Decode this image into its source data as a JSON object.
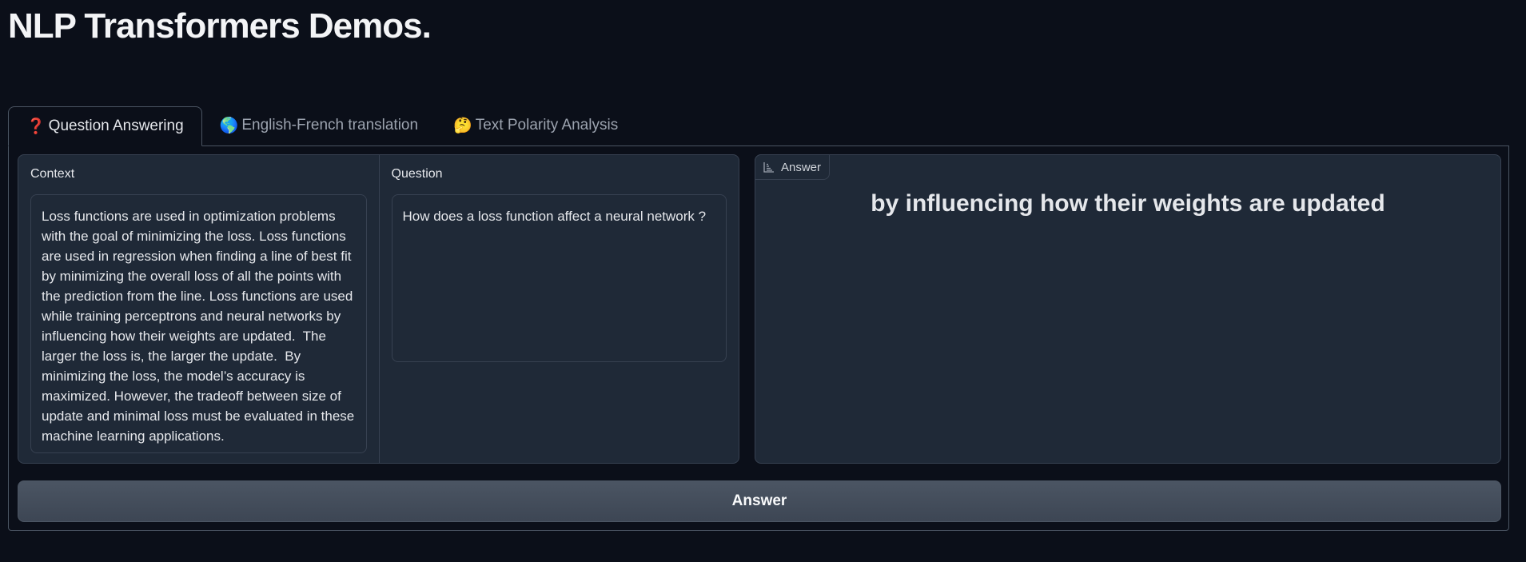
{
  "app": {
    "title": "NLP Transformers Demos."
  },
  "tabs": [
    {
      "icon": "❓",
      "label": "Question Answering"
    },
    {
      "icon": "🌎",
      "label": " English-French translation"
    },
    {
      "icon": "🤔",
      "label": "Text Polarity Analysis"
    }
  ],
  "qa": {
    "context_label": "Context",
    "context_value": "Loss functions are used in optimization problems with the goal of minimizing the loss. Loss functions are used in regression when finding a line of best fit by minimizing the overall loss of all the points with the prediction from the line. Loss functions are used while training perceptrons and neural networks by influencing how their weights are updated.  The larger the loss is, the larger the update.  By minimizing the loss, the model’s accuracy is maximized. However, the tradeoff between size of update and minimal loss must be evaluated in these machine learning applications.",
    "question_label": "Question",
    "question_value": "How does a loss function affect a neural network ?",
    "answer_label": "Answer",
    "answer_value": "by influencing how their weights are updated",
    "button_label": "Answer"
  },
  "colors": {
    "background": "#0b0f19",
    "panel": "#1f2937",
    "border": "#374151",
    "button": "#4b5563"
  },
  "icons": {
    "answer_badge": "bar-chart-icon"
  }
}
